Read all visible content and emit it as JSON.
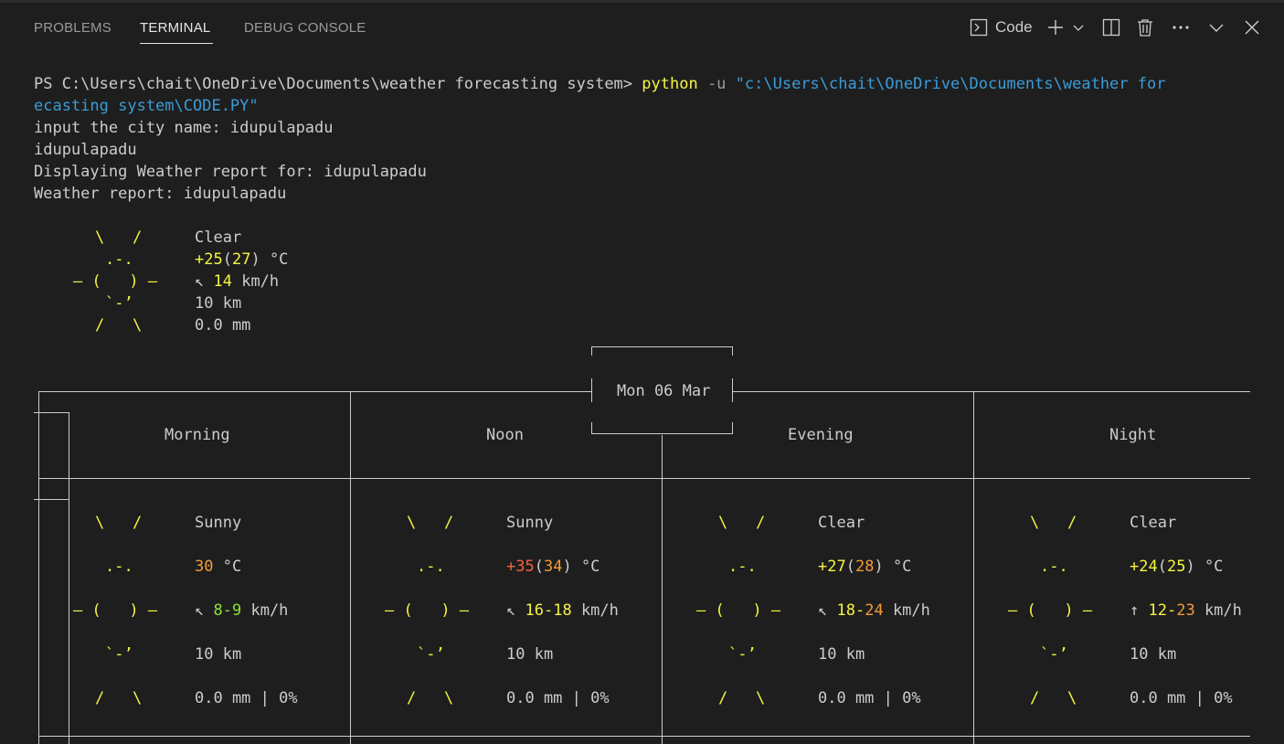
{
  "tabs": [
    {
      "label": "PROBLEMS"
    },
    {
      "label": "TERMINAL"
    },
    {
      "label": "DEBUG CONSOLE"
    }
  ],
  "toolbar": {
    "shell_label": "Code",
    "icons": [
      "terminal-icon",
      "plus-icon",
      "chevron-down-icon",
      "split-icon",
      "trash-icon",
      "ellipsis-icon",
      "chevron-down-icon",
      "close-icon"
    ]
  },
  "terminal": {
    "prompt": "PS C:\\Users\\chait\\OneDrive\\Documents\\weather forecasting system> ",
    "cmd": "python",
    "flag": " -u ",
    "path_part1": "\"c:\\Users\\chait\\OneDrive\\Documents\\weather for",
    "path_part2": "ecasting system\\CODE.PY\"",
    "out1": "input the city name: idupulapadu",
    "out2": "idupulapadu",
    "out3": "Displaying Weather report for: idupulapadu",
    "out4": "Weather report: idupulapadu"
  },
  "current": {
    "art": [
      "\\   /",
      ".-.",
      "― (   ) ―",
      "`-’",
      "/   \\"
    ],
    "condition": "Clear",
    "temp": "+25",
    "feels": "27",
    "unit": " °C",
    "wind_arrow": "↖ ",
    "wind": "14",
    "wind_unit": " km/h",
    "visibility": "10 km",
    "precip": "0.0 mm"
  },
  "forecast": {
    "date": "Mon 06 Mar",
    "periods": [
      {
        "name": "Morning",
        "condition": "Sunny",
        "temp": "30",
        "temp_plain": true,
        "feels": "",
        "unit": " °C",
        "wind_arrow": "↖ ",
        "wind_lo": "8",
        "wind_hi": "9",
        "wind_unit": " km/h",
        "visibility": "10 km",
        "precip": "0.0 mm | 0%"
      },
      {
        "name": "Noon",
        "condition": "Sunny",
        "temp": "+35",
        "temp_plain": false,
        "feels": "34",
        "unit": " °C",
        "wind_arrow": "↖ ",
        "wind_lo": "16",
        "wind_hi": "18",
        "wind_unit": " km/h",
        "visibility": "10 km",
        "precip": "0.0 mm | 0%"
      },
      {
        "name": "Evening",
        "condition": "Clear",
        "temp": "+27",
        "temp_plain": false,
        "feels": "28",
        "unit": " °C",
        "wind_arrow": "↖ ",
        "wind_lo": "18",
        "wind_hi": "24",
        "wind_unit": " km/h",
        "visibility": "10 km",
        "precip": "0.0 mm | 0%"
      },
      {
        "name": "Night",
        "condition": "Clear",
        "temp": "+24",
        "temp_plain": false,
        "feels": "25",
        "unit": " °C",
        "wind_arrow": "↑ ",
        "wind_lo": "12",
        "wind_hi": "23",
        "wind_unit": " km/h",
        "visibility": "10 km",
        "precip": "0.0 mm | 0%"
      }
    ]
  }
}
